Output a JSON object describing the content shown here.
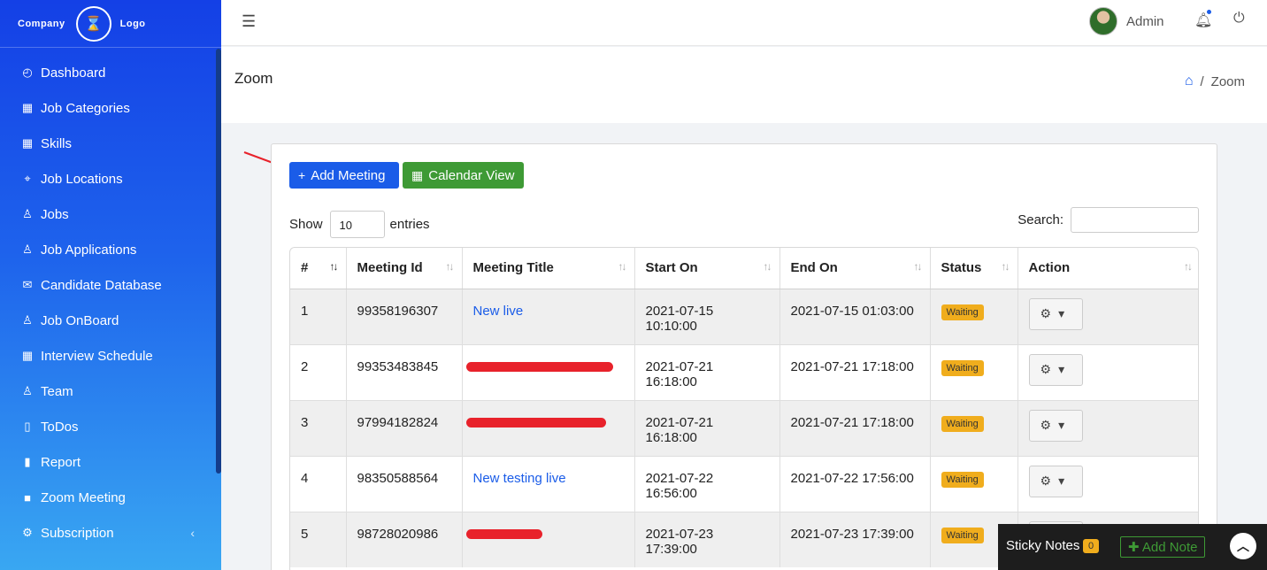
{
  "brand": {
    "left": "Company",
    "right": "Logo"
  },
  "sidebar": {
    "items": [
      {
        "label": "Dashboard",
        "icon": "gauge-icon",
        "glyph": "◴"
      },
      {
        "label": "Job Categories",
        "icon": "grid-icon",
        "glyph": "▦"
      },
      {
        "label": "Skills",
        "icon": "grid-icon",
        "glyph": "▦"
      },
      {
        "label": "Job Locations",
        "icon": "map-pin-icon",
        "glyph": "⌖"
      },
      {
        "label": "Jobs",
        "icon": "briefcase-icon",
        "glyph": "♙"
      },
      {
        "label": "Job Applications",
        "icon": "user-icon",
        "glyph": "♙"
      },
      {
        "label": "Candidate Database",
        "icon": "mail-icon",
        "glyph": "✉"
      },
      {
        "label": "Job OnBoard",
        "icon": "user-icon",
        "glyph": "♙"
      },
      {
        "label": "Interview Schedule",
        "icon": "calendar-icon",
        "glyph": "▦"
      },
      {
        "label": "Team",
        "icon": "team-icon",
        "glyph": "♙"
      },
      {
        "label": "ToDos",
        "icon": "note-icon",
        "glyph": "▯"
      },
      {
        "label": "Report",
        "icon": "bar-chart-icon",
        "glyph": "▮"
      },
      {
        "label": "Zoom Meeting",
        "icon": "video-icon",
        "glyph": "■"
      },
      {
        "label": "Subscription",
        "icon": "gear-icon",
        "glyph": "⚙",
        "chevron": "‹"
      }
    ]
  },
  "topbar": {
    "user": "Admin"
  },
  "page": {
    "title": "Zoom",
    "breadcrumb": "Zoom",
    "breadcrumb_sep": "/"
  },
  "toolbar": {
    "add_label": "Add Meeting",
    "calendar_label": "Calendar View"
  },
  "table_controls": {
    "show_label": "Show",
    "entries_value": "10",
    "entries_label": "entries",
    "search_label": "Search:"
  },
  "table": {
    "columns": [
      "#",
      "Meeting Id",
      "Meeting Title",
      "Start On",
      "End On",
      "Status",
      "Action"
    ],
    "rows": [
      {
        "num": "1",
        "id": "99358196307",
        "title": "New live",
        "start": "2021-07-15 10:10:00",
        "end": "2021-07-15 01:03:00",
        "status": "Waiting"
      },
      {
        "num": "2",
        "id": "99353483845",
        "title": "",
        "start": "2021-07-21 16:18:00",
        "end": "2021-07-21 17:18:00",
        "status": "Waiting"
      },
      {
        "num": "3",
        "id": "97994182824",
        "title": "",
        "start": "2021-07-21 16:18:00",
        "end": "2021-07-21 17:18:00",
        "status": "Waiting"
      },
      {
        "num": "4",
        "id": "98350588564",
        "title": "New testing live",
        "start": "2021-07-22 16:56:00",
        "end": "2021-07-22 17:56:00",
        "status": "Waiting"
      },
      {
        "num": "5",
        "id": "98728020986",
        "title": "",
        "start": "2021-07-23 17:39:00",
        "end": "2021-07-23 17:39:00",
        "status": "Waiting"
      }
    ]
  },
  "sticky": {
    "label": "Sticky Notes",
    "count": "0",
    "add_label": "Add Note"
  },
  "colors": {
    "primary": "#1a5ce8",
    "success": "#3e9a35",
    "warning": "#f0ad1d",
    "annotation_red": "#e8222b"
  }
}
